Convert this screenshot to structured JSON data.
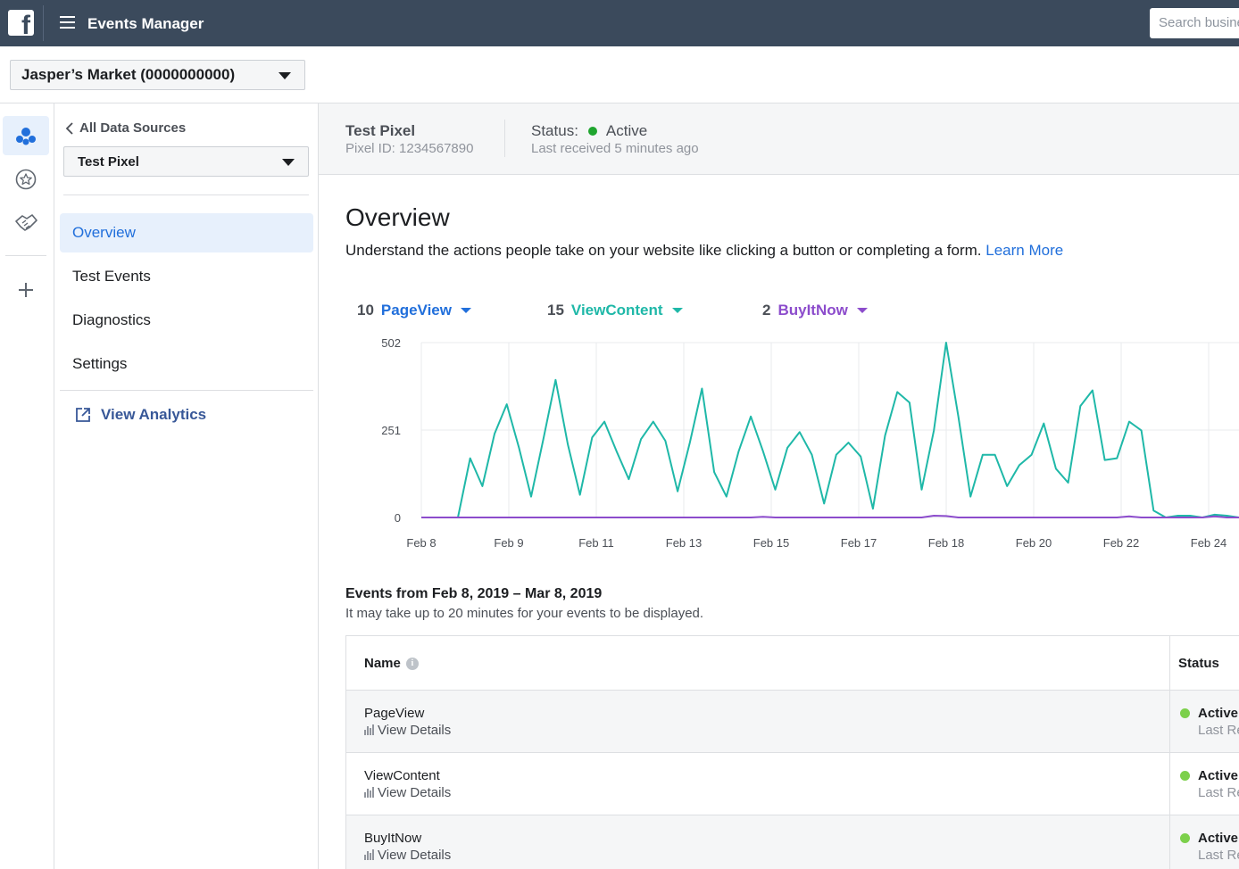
{
  "topbar": {
    "app_title": "Events Manager",
    "search_placeholder": "Search business"
  },
  "account": {
    "selected": "Jasper’s Market (0000000000)"
  },
  "sidenav": {
    "back_label": "All Data Sources",
    "pixel_selected": "Test Pixel",
    "items": [
      {
        "label": "Overview",
        "active": true
      },
      {
        "label": "Test Events",
        "active": false
      },
      {
        "label": "Diagnostics",
        "active": false
      },
      {
        "label": "Settings",
        "active": false
      }
    ],
    "analytics_label": "View Analytics"
  },
  "pixel_header": {
    "name": "Test Pixel",
    "pixel_id": "Pixel ID: 1234567890",
    "status_label": "Status:",
    "status_value": "Active",
    "last_received": "Last received 5 minutes ago"
  },
  "overview": {
    "title": "Overview",
    "description": "Understand the actions people take on your website like clicking a button or completing a form.",
    "learn_more": "Learn More"
  },
  "metrics": [
    {
      "count": "10",
      "name": "PageView",
      "color": "#216fdb"
    },
    {
      "count": "15",
      "name": "ViewContent",
      "color": "#1fb8a8"
    },
    {
      "count": "2",
      "name": "BuyItNow",
      "color": "#8c4ccc"
    }
  ],
  "chart_data": {
    "type": "line",
    "y_ticks": [
      "502",
      "251",
      "0"
    ],
    "ylim": [
      0,
      502
    ],
    "x_tick_labels": [
      "Feb 8",
      "Feb 9",
      "Feb 11",
      "Feb 13",
      "Feb 15",
      "Feb 17",
      "Feb 18",
      "Feb 20",
      "Feb 22",
      "Feb 24"
    ],
    "grid": true,
    "series": [
      {
        "name": "ViewContent",
        "color": "#1fb8a8",
        "values": [
          0,
          0,
          0,
          0,
          170,
          90,
          240,
          325,
          200,
          60,
          225,
          395,
          210,
          65,
          230,
          275,
          190,
          110,
          225,
          275,
          220,
          75,
          215,
          370,
          130,
          60,
          190,
          290,
          190,
          80,
          200,
          245,
          180,
          40,
          180,
          215,
          175,
          25,
          235,
          360,
          330,
          80,
          250,
          502,
          290,
          60,
          180,
          180,
          90,
          150,
          180,
          270,
          140,
          100,
          320,
          365,
          165,
          170,
          275,
          250,
          20,
          0,
          5,
          5,
          0,
          8,
          5,
          0
        ]
      },
      {
        "name": "BuyItNow",
        "color": "#8c4ccc",
        "values": [
          0,
          0,
          0,
          0,
          0,
          0,
          0,
          0,
          0,
          0,
          0,
          0,
          0,
          0,
          0,
          0,
          0,
          0,
          0,
          0,
          0,
          0,
          0,
          0,
          0,
          0,
          0,
          0,
          2,
          0,
          0,
          0,
          0,
          0,
          0,
          0,
          0,
          0,
          0,
          0,
          0,
          0,
          5,
          4,
          0,
          0,
          0,
          0,
          0,
          0,
          0,
          0,
          0,
          0,
          0,
          0,
          0,
          0,
          3,
          0,
          0,
          0,
          0,
          0,
          0,
          3,
          0,
          0
        ]
      }
    ]
  },
  "events": {
    "title": "Events from Feb 8, 2019 – Mar 8, 2019",
    "subtitle": "It may take up to 20 minutes for your events to be displayed.",
    "col_name": "Name",
    "col_status": "Status",
    "rows": [
      {
        "name": "PageView",
        "details": "View Details",
        "status": "Active",
        "last": "Last Received"
      },
      {
        "name": "ViewContent",
        "details": "View Details",
        "status": "Active",
        "last": "Last Received"
      },
      {
        "name": "BuyItNow",
        "details": "View Details",
        "status": "Active",
        "last": "Last Received"
      }
    ]
  }
}
